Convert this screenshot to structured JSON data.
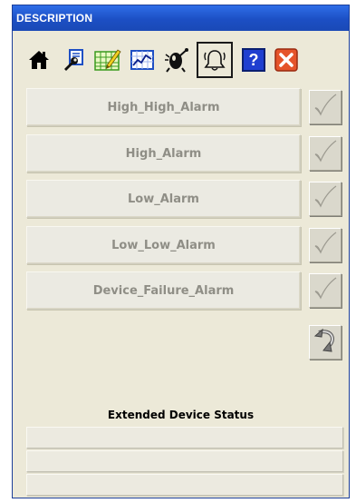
{
  "window": {
    "title": "DESCRIPTION"
  },
  "toolbar": {
    "buttons": [
      {
        "name": "home",
        "icon": "home-icon",
        "active": false
      },
      {
        "name": "configure",
        "icon": "wrench-icon",
        "active": false
      },
      {
        "name": "calibrate",
        "icon": "grid-pencil-icon",
        "active": false
      },
      {
        "name": "trend",
        "icon": "trend-chart-icon",
        "active": false
      },
      {
        "name": "diagnostics",
        "icon": "diagnostic-icon",
        "active": false
      },
      {
        "name": "alarms",
        "icon": "bell-icon",
        "active": true
      },
      {
        "name": "help",
        "icon": "help-icon",
        "active": false,
        "label": "?"
      },
      {
        "name": "close",
        "icon": "close-icon",
        "active": false
      }
    ]
  },
  "alarms": [
    {
      "label": "High_High_Alarm"
    },
    {
      "label": "High_Alarm"
    },
    {
      "label": "Low_Alarm"
    },
    {
      "label": "Low_Low_Alarm"
    },
    {
      "label": "Device_Failure_Alarm"
    }
  ],
  "extended_status": {
    "title": "Extended Device Status",
    "fields": [
      "",
      "",
      ""
    ]
  },
  "colors": {
    "titlebar": "#1c4fc4",
    "panel": "#ece9d8",
    "help_blue": "#1f3fd0",
    "close_orange": "#e5542a"
  }
}
